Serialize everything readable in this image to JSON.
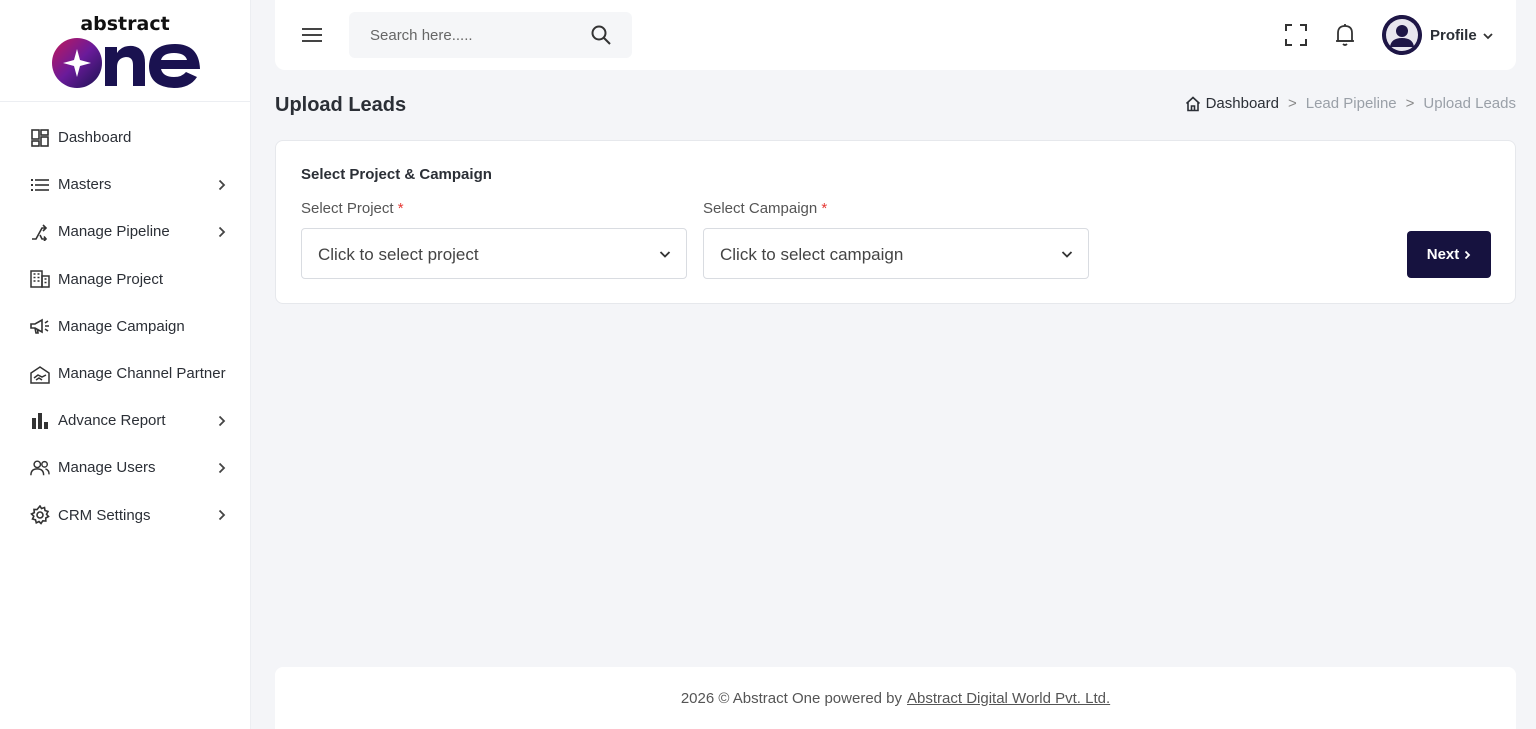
{
  "logo": {
    "text": "abstract one",
    "icon": "abstract-one-logo"
  },
  "sidebar": {
    "items": [
      {
        "label": "Dashboard",
        "icon": "dashboard-icon",
        "has_chevron": false
      },
      {
        "label": "Masters",
        "icon": "list-icon",
        "has_chevron": true
      },
      {
        "label": "Manage Pipeline",
        "icon": "pipeline-icon",
        "has_chevron": true
      },
      {
        "label": "Manage Project",
        "icon": "building-icon",
        "has_chevron": false
      },
      {
        "label": "Manage Campaign",
        "icon": "megaphone-icon",
        "has_chevron": false
      },
      {
        "label": "Manage Channel Partner",
        "icon": "handshake-icon",
        "has_chevron": false
      },
      {
        "label": "Advance Report",
        "icon": "bar-chart-icon",
        "has_chevron": true
      },
      {
        "label": "Manage Users",
        "icon": "users-icon",
        "has_chevron": true
      },
      {
        "label": "CRM Settings",
        "icon": "gear-icon",
        "has_chevron": true
      }
    ]
  },
  "header": {
    "search_placeholder": "Search here.....",
    "profile_label": "Profile"
  },
  "page": {
    "title": "Upload Leads",
    "breadcrumb": {
      "home": "Dashboard",
      "middle": "Lead Pipeline",
      "current": "Upload Leads",
      "separator": ">"
    }
  },
  "form": {
    "section_title": "Select Project & Campaign",
    "project": {
      "label": "Select Project",
      "required_mark": "*",
      "value": "Click to select project"
    },
    "campaign": {
      "label": "Select Campaign",
      "required_mark": "*",
      "value": "Click to select campaign"
    },
    "next_label": "Next"
  },
  "footer": {
    "text": "2026 © Abstract One powered by",
    "link": "Abstract Digital World Pvt. Ltd."
  },
  "colors": {
    "brand_dark": "#16123f",
    "required": "#e53935",
    "logo_gradient_start": "#7b1fa2",
    "logo_gradient_end": "#1a1250"
  }
}
